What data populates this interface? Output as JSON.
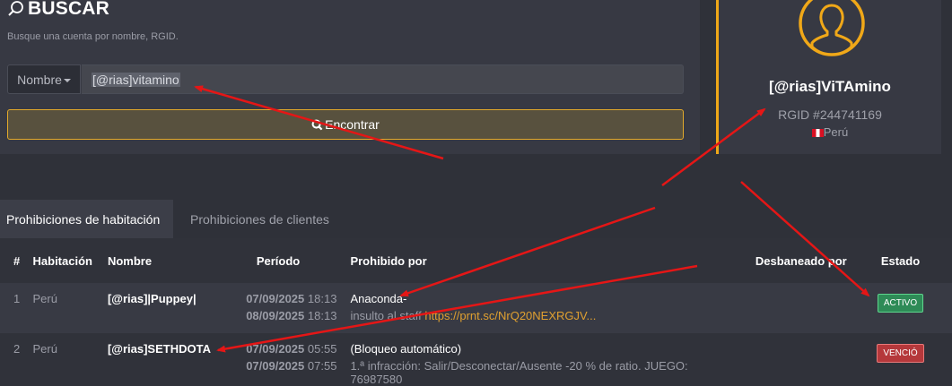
{
  "search": {
    "title": "BUSCAR",
    "subtitle": "Busque una cuenta por nombre, RGID.",
    "filter_label": "Nombre",
    "input_value": "[@rias]vitamino",
    "find_button": "Encontrar"
  },
  "profile": {
    "name": "[@rias]ViTAmino",
    "rgid": "RGID #244741169",
    "country": "Perú"
  },
  "tabs": [
    {
      "label": "Prohibiciones de habitación",
      "active": true
    },
    {
      "label": "Prohibiciones de clientes",
      "active": false
    }
  ],
  "table": {
    "headers": [
      "#",
      "Habitación",
      "Nombre",
      "Período",
      "Prohibido por",
      "Desbaneado por",
      "Estado"
    ],
    "rows": [
      {
        "num": "1",
        "room": "Perú",
        "name": "[@rias]|Puppey|",
        "start_date": "07/09/2025",
        "start_time": "18:13",
        "end_date": "08/09/2025",
        "end_time": "18:13",
        "banned_by": "Anaconda-",
        "reason": "insulto al staff",
        "reason_link": "https://prnt.sc/NrQ20NEXRGJV...",
        "unbanned_by": "",
        "status": "ACTIVO"
      },
      {
        "num": "2",
        "room": "Perú",
        "name": "[@rias]SETHDOTA",
        "start_date": "07/09/2025",
        "start_time": "05:55",
        "end_date": "07/09/2025",
        "end_time": "07:55",
        "banned_by": "(Bloqueo automático)",
        "reason": "1.ª infracción: Salir/Desconectar/Ausente -20 % de ratio. JUEGO:",
        "reason_cont": "76987580",
        "unbanned_by": "",
        "status": "VENCIÓ"
      }
    ]
  },
  "colors": {
    "accent": "#f0a818",
    "arrow": "#e51616",
    "active_badge": "#2e8b57",
    "expired_badge": "#b5383b"
  },
  "icons": [
    "search-icon",
    "user-avatar-icon",
    "peru-flag-icon",
    "caret-down-icon"
  ]
}
